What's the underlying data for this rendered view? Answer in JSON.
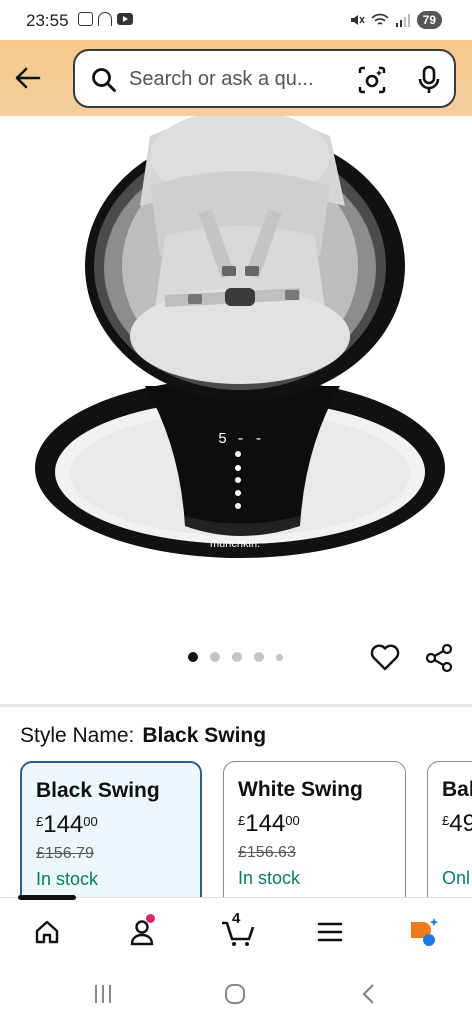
{
  "status_bar": {
    "time": "23:55",
    "battery": "79",
    "icons": [
      "screen-record-icon",
      "headphones-icon",
      "youtube-icon",
      "mute-icon",
      "wifi-icon",
      "signal-icon"
    ]
  },
  "header": {
    "search_placeholder": "Search or ask a qu...",
    "icons": [
      "back-arrow-icon",
      "search-icon",
      "lens-icon",
      "mic-icon"
    ]
  },
  "product": {
    "image_brand_mark": "munchkin.",
    "image_display_number": "5 - -",
    "carousel": {
      "count": 5,
      "active_index": 0
    }
  },
  "style": {
    "label": "Style Name:",
    "value": "Black Swing"
  },
  "variants": [
    {
      "title": "Black Swing",
      "currency": "£",
      "price_whole": "144",
      "price_fraction": "00",
      "was_price": "£156.79",
      "stock": "In stock",
      "selected": true
    },
    {
      "title": "White Swing",
      "currency": "£",
      "price_whole": "144",
      "price_fraction": "00",
      "was_price": "£156.63",
      "stock": "In stock",
      "selected": false
    },
    {
      "title": "Bal",
      "currency": "£",
      "price_whole": "49",
      "price_fraction": "",
      "was_price": "",
      "stock": "Onl",
      "selected": false
    }
  ],
  "bottom_nav": {
    "cart_count": "4",
    "items": [
      "home-icon",
      "account-icon",
      "cart-icon",
      "menu-icon",
      "rufus-icon"
    ]
  },
  "colors": {
    "header_bg": "#f6c88a",
    "selected_border": "#2e5f8c",
    "selected_bg": "#eef7fc",
    "stock_green": "#067d62",
    "notif_pink": "#e0246b"
  }
}
